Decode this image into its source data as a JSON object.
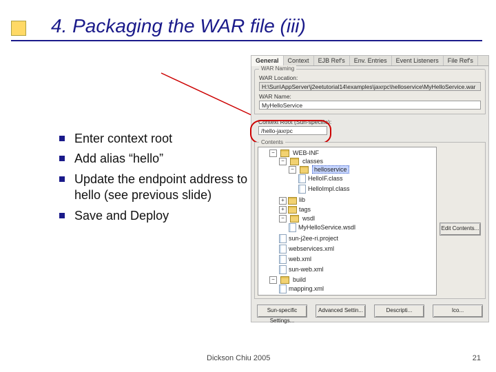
{
  "slide": {
    "title": "4. Packaging the WAR file (iii)",
    "author": "Dickson Chiu 2005",
    "page": "21"
  },
  "bullets": [
    "Enter context root",
    "Add alias “hello”",
    "Update the endpoint address to hello (see previous slide)",
    "Save and Deploy"
  ],
  "screenshot": {
    "tabs": [
      "General",
      "Context",
      "EJB Ref's",
      "Env. Entries",
      "Event Listeners",
      "File Ref's"
    ],
    "active_tab": 0,
    "war_naming_group": "WAR Naming",
    "war_location_label": "WAR Location:",
    "war_location_value": "H:\\Sun\\AppServer\\j2eetutorial14\\examples\\jaxrpc\\helloservice\\MyHelloService.war",
    "war_name_label": "WAR Name:",
    "war_name_value": "MyHelloService",
    "context_root_label": "Context Root (Sun-specific):",
    "context_root_value": "/hello-jaxrpc",
    "contents_group": "Contents",
    "tree": {
      "root": "WEB-INF",
      "items": [
        {
          "label": "classes",
          "open": true,
          "children": [
            {
              "label": "helloservice",
              "open": true,
              "selected": true,
              "children": [
                {
                  "label": "HelloIF.class",
                  "type": "file"
                },
                {
                  "label": "HelloImpl.class",
                  "type": "file"
                }
              ]
            }
          ]
        },
        {
          "label": "lib",
          "type": "folder"
        },
        {
          "label": "tags",
          "type": "folder"
        },
        {
          "label": "wsdl",
          "open": true,
          "children": [
            {
              "label": "MyHelloService.wsdl",
              "type": "file"
            }
          ]
        },
        {
          "label": "sun-j2ee-ri.project",
          "type": "file"
        },
        {
          "label": "webservices.xml",
          "type": "file"
        },
        {
          "label": "web.xml",
          "type": "file"
        },
        {
          "label": "sun-web.xml",
          "type": "file"
        },
        {
          "label": "build",
          "open": true,
          "toplevel": true,
          "children": [
            {
              "label": "mapping.xml",
              "type": "file"
            }
          ]
        }
      ]
    },
    "edit_contents_btn": "Edit Contents...",
    "bottom_buttons": [
      "Sun-specific Settings...",
      "Advanced Settin...",
      "Descripti...",
      "Ico..."
    ]
  }
}
